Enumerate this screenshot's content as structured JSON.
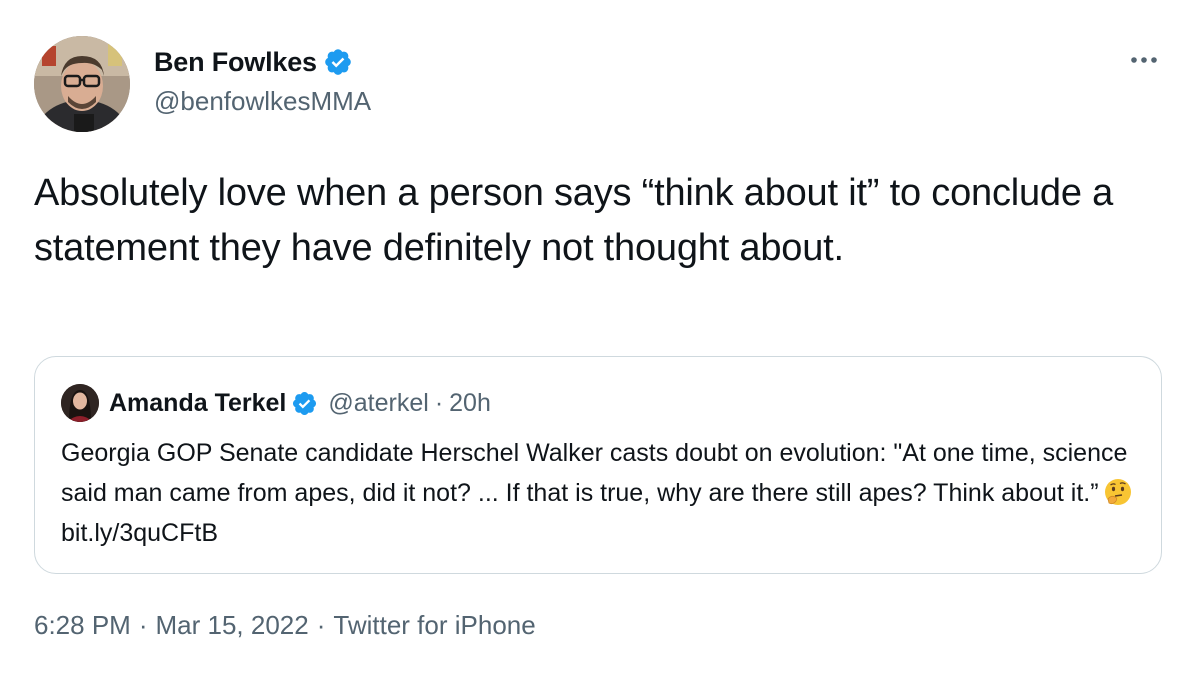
{
  "tweet": {
    "author": {
      "display_name": "Ben Fowlkes",
      "handle": "@benfowlkesMMA",
      "verified": true
    },
    "more_icon": "more-horizontal-icon",
    "text": "Absolutely love when a person says “think about it” to conclude a statement they have definitely not thought about.",
    "quoted": {
      "author": {
        "display_name": "Amanda Terkel",
        "handle": "@aterkel",
        "verified": true
      },
      "separator": "·",
      "time": "20h",
      "text": "Georgia GOP Senate candidate Herschel Walker casts doubt on evolution: \"At one time, science said man came from apes, did it not? ... If that is true, why are there still apes? Think about it.”",
      "emoji": "thinking-face-icon",
      "link": "bit.ly/3quCFtB"
    },
    "meta": {
      "time": "6:28 PM",
      "sep": "·",
      "date": "Mar 15, 2022",
      "source": "Twitter for iPhone"
    }
  },
  "colors": {
    "verified_blue": "#1d9bf0",
    "text_primary": "#0f1419",
    "text_secondary": "#536471",
    "border": "#cfd9de"
  }
}
